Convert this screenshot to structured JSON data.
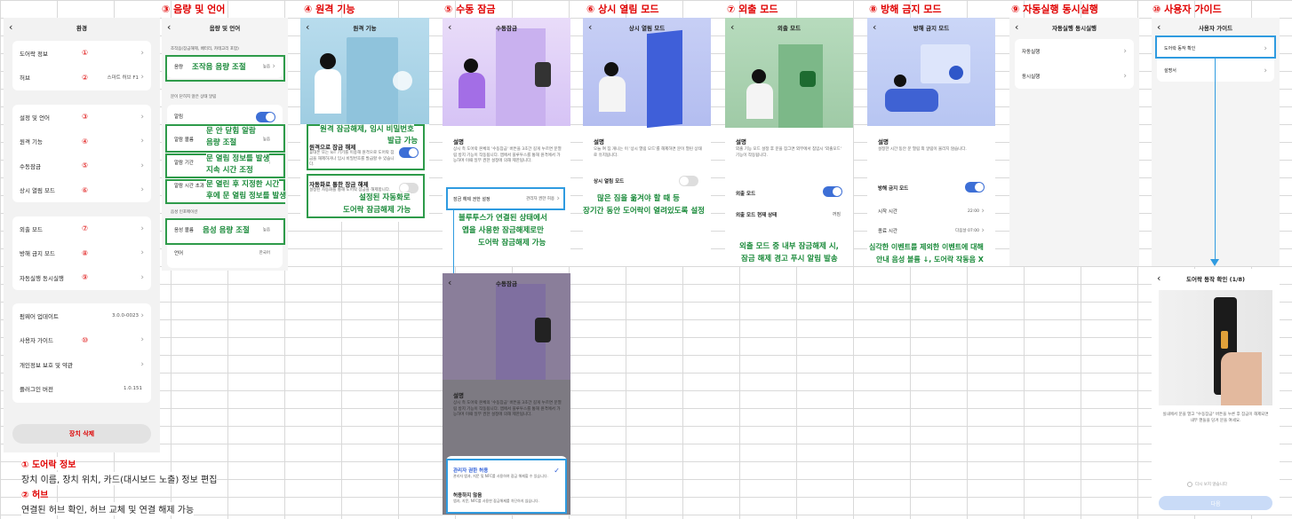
{
  "headers": [
    "③ 음량 및 언어",
    "④ 원격 기능",
    "⑤ 수동 잠금",
    "⑥ 상시 열림 모드",
    "⑦ 외출 모드",
    "⑧ 방해 금지 모드",
    "⑨ 자동실행 동시실행",
    "⑩ 사용자 가이드"
  ],
  "settings": {
    "title": "환경",
    "items": [
      "도어락 정보",
      "허브",
      "설정 및 언어",
      "원격 기능",
      "수동잠금",
      "상시 열림 모드",
      "외출 모드",
      "방해 금지 모드",
      "자동실행 동시실행",
      "펌웨어 업데이트",
      "사용자 가이드",
      "개인정보 보호 및 약관",
      "플러그인 버전"
    ],
    "nums": [
      "①",
      "②",
      "③",
      "④",
      "⑤",
      "⑥",
      "⑦",
      "⑧",
      "⑨",
      "",
      "⑩",
      "",
      ""
    ],
    "hub_value": "스마트 허브 F1",
    "fw_value": "3.0.0-0023",
    "plugin_value": "1.0.151",
    "delete": "장치 삭제"
  },
  "volume": {
    "title": "음량 및 언어",
    "sub1": "조작음(잠금해제, 배터리, 카테고리 포함)",
    "row_volume": "음량",
    "row_volume_val": "높음",
    "sub2": "문이 닫히지 않은 상태 알림",
    "row_alert": "알림",
    "row_vol2": "알람 볼륨",
    "row_vol2_val": "높음",
    "row_time": "알람 기간",
    "row_time_val": "높음",
    "row_close": "알람 시간 초과",
    "sub3": "음성 인포메이션",
    "row_voice": "음성 볼륨",
    "row_voice_val": "높음",
    "row_lang": "언어",
    "row_lang_val": "한국어"
  },
  "volume_notes": [
    "조작음 음량 조절",
    "문 안 닫힘 알람",
    "음량 조절",
    "문 열림 정보를 발생",
    "지속 시간 조정",
    "문 열린 후 지정한 시간",
    "후에 문 열림 정보를 발생",
    "음성 음량 조절"
  ],
  "remote": {
    "title": "원격 기능",
    "row1": "원격으로 잠금 해제",
    "row1_desc": "휴대폰 또는 IoT 기기를 이용해 원격으로 도어락 잠금을 해제하거나 임시 비밀번호를 발급할 수 있습니다.",
    "row2": "자동화로 통한 잠금 해제",
    "row2_desc": "설정된 자동화를 통해 도어락 잠금을 해제합니다."
  },
  "remote_notes": [
    "원격 잠금해제, 임시 비밀번호",
    "발급 가능",
    "설정된 자동화로",
    "도어락 잠금해제 가능"
  ],
  "manual": {
    "title": "수동잠금",
    "desc_title": "설명",
    "desc": "상시 측 도어락 본체의 '수동잠금' 버튼을 3초간 길게 누르면 문열림 방지 기능이 작동됩니다. 앱에서 블루투스를 통해 원격에서 가능하며 이때 일부 권한 설정에 의해 제한됩니다.",
    "row": "잠금 해제 권한 설정",
    "row_val": "관리자 권한 허용",
    "opt1": "관리자 권한 허용",
    "opt1_desc": "관리자 앱과, 지문 및 NFC를 사용하여 잠금 해제할 수 있습니다.",
    "opt2": "허용하지 않음",
    "opt2_desc": "앱과, 지문, NFC를 사용한 잠금해제를 차단하지 않습니다."
  },
  "manual_notes": [
    "블루투스가 연결된 상태에서",
    "앱을 사용한 잠금해제로만",
    "도어락 잠금해제 가능"
  ],
  "always_open": {
    "title": "상시 열림 모드",
    "desc_title": "설명",
    "desc": "오늘 여 짐 개니는 이 '상시 열림 모드'를 해제하면 문이 열린 상태로 유지됩니다.",
    "row": "상시 열림 모드"
  },
  "always_notes": [
    "많은 짐을 옮겨야 할 때 등",
    "장기간 동안 도어락이 열려있도록 설정"
  ],
  "away": {
    "title": "외출 모드",
    "desc_title": "설명",
    "desc": "외출 기능 모드 설정 후 문을 잠그면 외부에서 침입시 '외출모드' 기능이 작동됩니다.",
    "row": "외출 모드",
    "status": "외출 모드 현재 상태",
    "status_val": "꺼짐"
  },
  "away_notes": [
    "외출 모드 중 내부 잠금해제 시,",
    "잠금 해제 경고 푸시 알림 발송"
  ],
  "dnd": {
    "title": "방해 금지 모드",
    "desc_title": "설명",
    "desc": "설정한 시간 동안 문 열림 외 알림이 울리지 않습니다.",
    "row": "방해 금지 모드",
    "start": "시작 시간",
    "start_val": "22:00",
    "end": "종료 시간",
    "end_val": "다음날 07:00"
  },
  "dnd_notes": [
    "심각한 이벤트를 제외한 이벤트에 대해",
    "안내 음성 볼륨 ↓, 도어락 작동음 X"
  ],
  "auto": {
    "title": "자동실행 동시실행",
    "items": [
      "자동실행",
      "동시실행"
    ]
  },
  "guide": {
    "title": "사용자 가이드",
    "items": [
      "도어락 동작 확인",
      "설명서"
    ],
    "sub_title": "도어락 동작 확인 (1/8)",
    "sub_desc": "실내에서 문을 열고 \"수동잠금\" 버튼을 누른 후 잠금이 해제되면 내부 핸들을 당겨 문을 여세요.",
    "checkbox": "다시 보지 않습니다",
    "next": "다음"
  },
  "footnotes": {
    "n1_title": "① 도어락 정보",
    "n1_body": "장치 이름, 장치 위치, 카드(대시보드 노출) 정보 편집",
    "n2_title": "② 허브",
    "n2_body": "연결된 허브 확인, 허브 교체 및 연결 해제 가능"
  }
}
